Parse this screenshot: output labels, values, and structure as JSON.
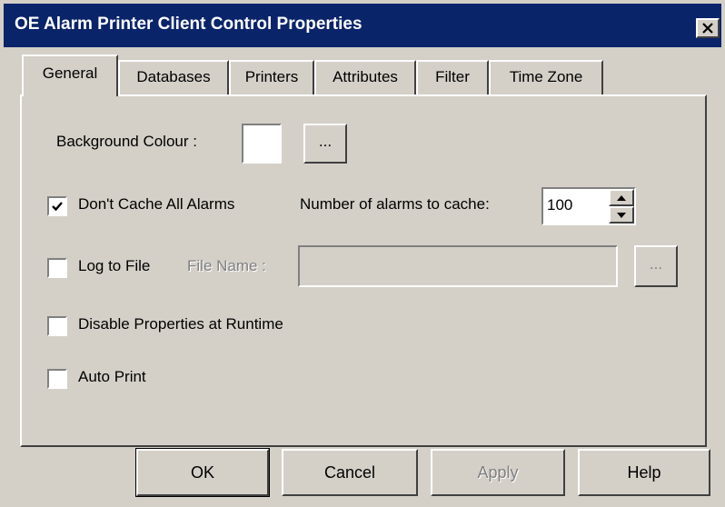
{
  "window": {
    "title": "OE Alarm Printer Client Control Properties",
    "close_icon": "close-icon"
  },
  "tabs": [
    {
      "label": "General",
      "active": true
    },
    {
      "label": "Databases",
      "active": false
    },
    {
      "label": "Printers",
      "active": false
    },
    {
      "label": "Attributes",
      "active": false
    },
    {
      "label": "Filter",
      "active": false
    },
    {
      "label": "Time Zone",
      "active": false
    }
  ],
  "general": {
    "background_colour_label": "Background Colour :",
    "background_colour_value": "#ffffff",
    "browse_label": "...",
    "dont_cache": {
      "label": "Don't Cache All Alarms",
      "checked": true
    },
    "num_alarms_label": "Number of alarms to cache:",
    "num_alarms_value": "100",
    "log_to_file": {
      "label": "Log to File",
      "checked": false
    },
    "file_name_label": "File Name :",
    "file_name_value": "",
    "file_browse_label": "...",
    "disable_props": {
      "label": "Disable Properties at Runtime",
      "checked": false
    },
    "auto_print": {
      "label": "Auto Print",
      "checked": false
    }
  },
  "footer": {
    "ok": "OK",
    "cancel": "Cancel",
    "apply": "Apply",
    "help": "Help"
  }
}
